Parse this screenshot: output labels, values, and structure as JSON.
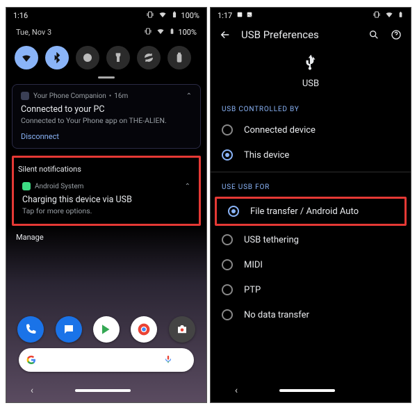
{
  "left": {
    "status_time": "1:16",
    "date": "Tue, Nov 3",
    "battery": "100%",
    "quick_settings": [
      {
        "name": "wifi-toggle",
        "active": true
      },
      {
        "name": "bluetooth-toggle",
        "active": true
      },
      {
        "name": "dnd-toggle",
        "active": false
      },
      {
        "name": "flashlight-toggle",
        "active": false
      },
      {
        "name": "autorotate-toggle",
        "active": false
      },
      {
        "name": "battery-saver-toggle",
        "active": false
      }
    ],
    "notif1": {
      "app": "Your Phone Companion",
      "age": "16m",
      "title": "Connected to your PC",
      "sub": "Connected to Your Phone app on THE-ALIEN.",
      "action": "Disconnect"
    },
    "silent_label": "Silent notifications",
    "notif2": {
      "app": "Android System",
      "title": "Charging this device via USB",
      "sub": "Tap for more options."
    },
    "manage": "Manage",
    "apps": [
      "phone-app",
      "messages-app",
      "play-store-app",
      "chrome-app",
      "camera-app"
    ]
  },
  "right": {
    "status_time": "1:17",
    "title": "USB Preferences",
    "usb_label": "USB",
    "group1": "USB CONTROLLED BY",
    "controlled_by": [
      {
        "label": "Connected device",
        "selected": false
      },
      {
        "label": "This device",
        "selected": true
      }
    ],
    "group2": "USE USB FOR",
    "use_for": [
      {
        "label": "File transfer / Android Auto",
        "selected": true,
        "highlight": true
      },
      {
        "label": "USB tethering",
        "selected": false
      },
      {
        "label": "MIDI",
        "selected": false
      },
      {
        "label": "PTP",
        "selected": false
      },
      {
        "label": "No data transfer",
        "selected": false
      }
    ]
  }
}
